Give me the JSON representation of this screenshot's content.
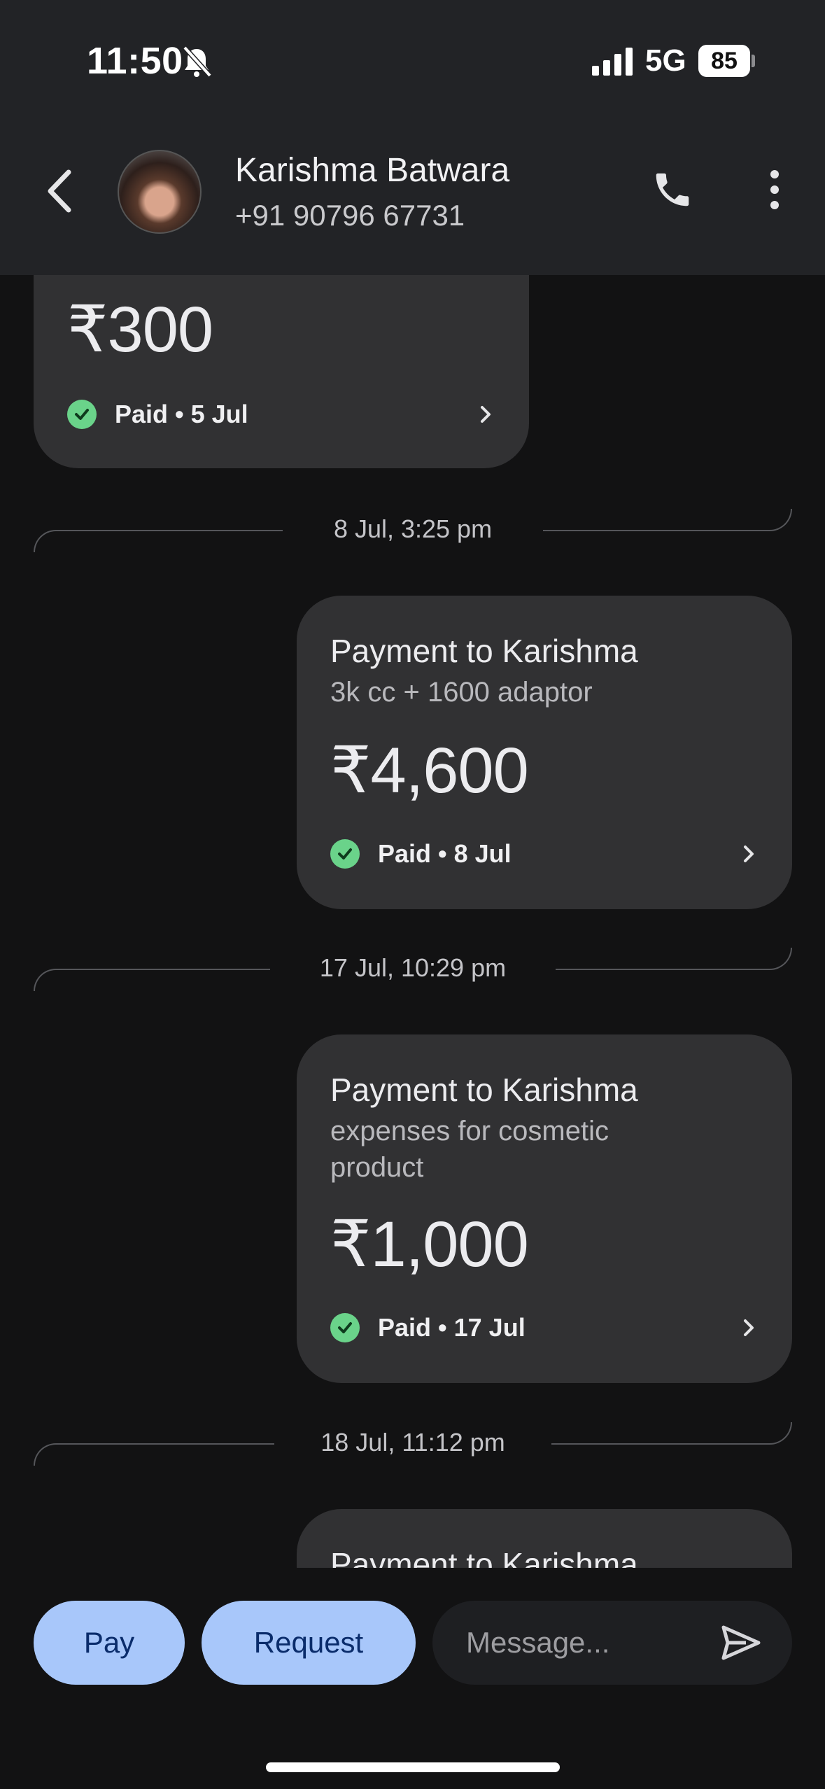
{
  "status_bar": {
    "time": "11:50",
    "network": "5G",
    "battery": "85",
    "icons": [
      "bell-off-icon",
      "signal-icon",
      "battery-icon"
    ]
  },
  "header": {
    "back_icon": "back-arrow-icon",
    "contact_name": "Karishma Batwara",
    "contact_phone": "+91 90796 67731",
    "call_icon": "phone-icon",
    "menu_icon": "more-vert-icon"
  },
  "messages": [
    {
      "amount": "₹300",
      "status": "Paid • 5 Jul"
    },
    {
      "date_divider": "8 Jul, 3:25 pm",
      "title": "Payment to Karishma",
      "note": "3k cc + 1600 adaptor",
      "amount": "₹4,600",
      "status": "Paid • 8 Jul"
    },
    {
      "date_divider": "17 Jul, 10:29 pm",
      "title": "Payment to Karishma",
      "note": "expenses for cosmetic product",
      "amount": "₹1,000",
      "status": "Paid • 17 Jul"
    },
    {
      "date_divider": "18 Jul, 11:12 pm",
      "title": "Payment to Karishma"
    }
  ],
  "composer": {
    "pay_label": "Pay",
    "request_label": "Request",
    "message_placeholder": "Message...",
    "send_icon": "send-icon"
  },
  "colors": {
    "accent": "#a8c7fa",
    "paid_check": "#6ad38a",
    "card_bg": "#313133",
    "page_bg": "#121213"
  }
}
